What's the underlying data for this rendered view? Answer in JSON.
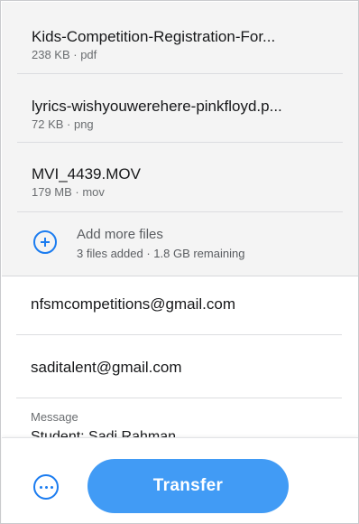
{
  "files": [
    {
      "name": "Kids-Competition-Registration-For...",
      "meta": "238 KB · pdf"
    },
    {
      "name": "lyrics-wishyouwerehere-pinkfloyd.p...",
      "meta": "72 KB · png"
    },
    {
      "name": "MVI_4439.MOV",
      "meta": "179 MB · mov"
    }
  ],
  "add_files": {
    "label": "Add more files",
    "status": "3 files added · 1.8 GB remaining",
    "icon": "plus-circle-icon"
  },
  "form": {
    "email_to": "nfsmcompetitions@gmail.com",
    "email_from": "saditalent@gmail.com",
    "message_label": "Message",
    "message_value": "Student: Sadi Rahman"
  },
  "actions": {
    "more_icon": "more-options-icon",
    "transfer_label": "Transfer"
  },
  "colors": {
    "accent": "#1b7cf0",
    "button": "#419bf5",
    "file_list_bg": "#f4f4f4"
  }
}
